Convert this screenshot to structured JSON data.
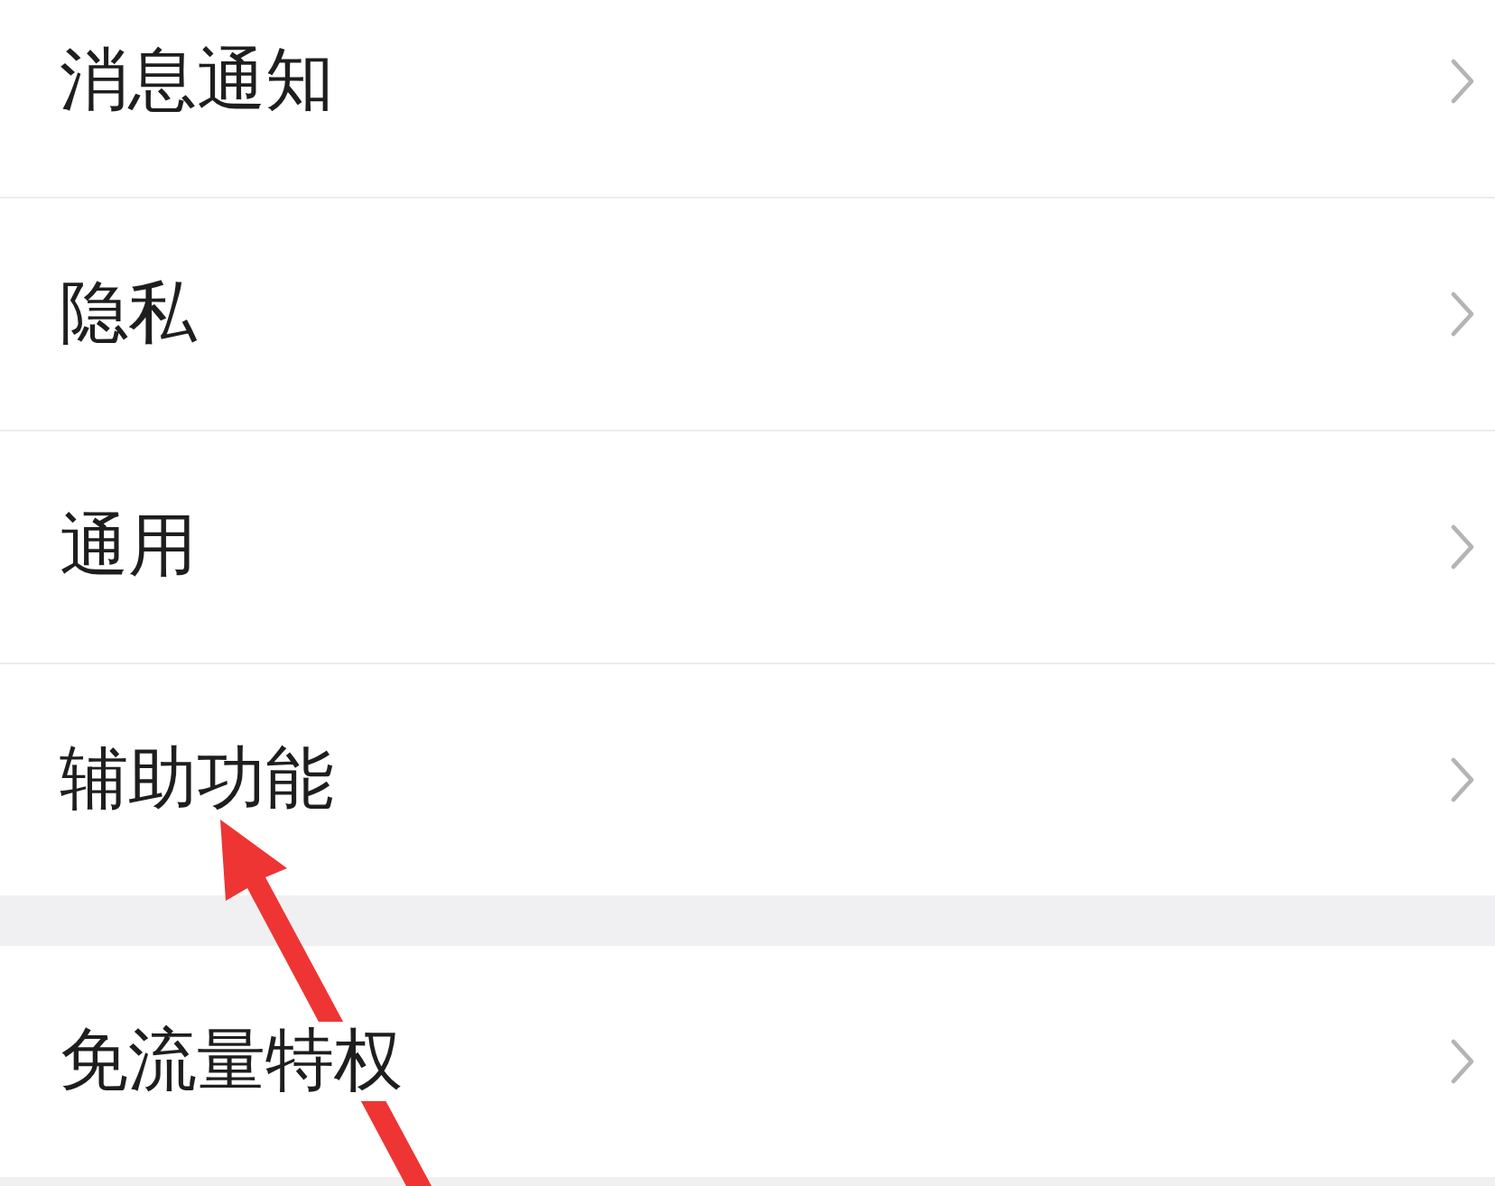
{
  "settings_list": {
    "groups": [
      {
        "items": [
          {
            "label": "消息通知"
          },
          {
            "label": "隐私"
          },
          {
            "label": "通用"
          },
          {
            "label": "辅助功能"
          }
        ]
      },
      {
        "items": [
          {
            "label": "免流量特权"
          }
        ]
      }
    ]
  }
}
